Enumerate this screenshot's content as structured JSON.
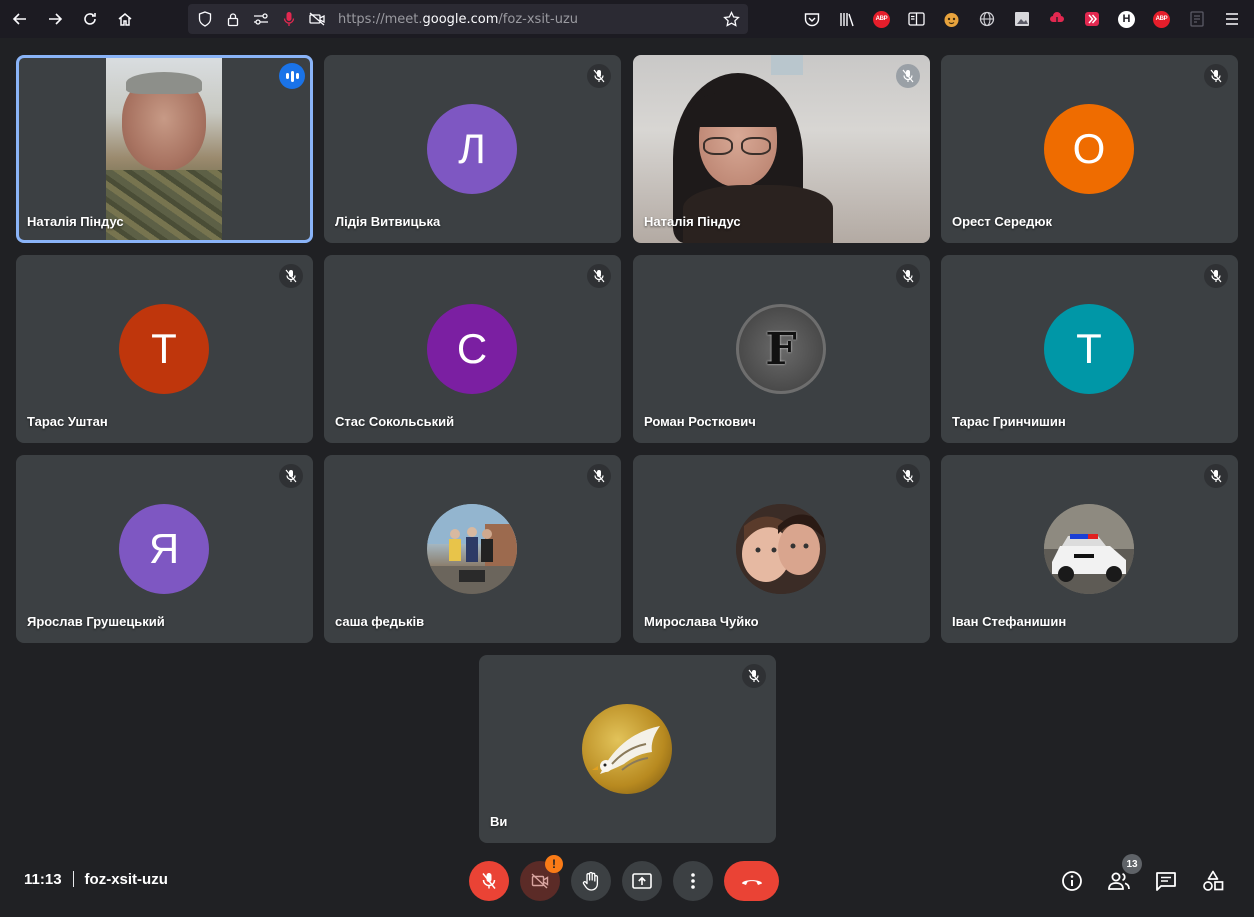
{
  "browser": {
    "url_prefix": "https://meet.",
    "url_domain": "google.com",
    "url_path": "/foz-xsit-uzu",
    "extensions": [
      {
        "icon": "pocket-icon"
      },
      {
        "icon": "library-icon"
      },
      {
        "icon": "adblock-icon",
        "label": "ABP"
      },
      {
        "icon": "reader-view-icon"
      },
      {
        "icon": "fox-extension-icon"
      },
      {
        "icon": "globe-icon"
      },
      {
        "icon": "screenshot-icon"
      },
      {
        "icon": "save-extension-icon"
      },
      {
        "icon": "video-extension-icon"
      },
      {
        "icon": "h-extension-icon",
        "label": "H"
      },
      {
        "icon": "adblock-icon-2",
        "label": "ABP"
      },
      {
        "icon": "disabled-extension-icon"
      },
      {
        "icon": "menu-icon"
      }
    ]
  },
  "participants": [
    {
      "name": "Наталія Піндус",
      "type": "video",
      "speaking": true
    },
    {
      "name": "Лідія Витвицька",
      "type": "letter",
      "letter": "Л",
      "color": "#7e57c2",
      "muted": true
    },
    {
      "name": "Наталія Піндус",
      "type": "video",
      "muted": true
    },
    {
      "name": "Орест Середюк",
      "type": "letter",
      "letter": "О",
      "color": "#ef6c00",
      "muted": true
    },
    {
      "name": "Тарас Уштан",
      "type": "letter",
      "letter": "Т",
      "color": "#bf360c",
      "muted": true
    },
    {
      "name": "Стас Сокольський",
      "type": "letter",
      "letter": "С",
      "color": "#7b1fa2",
      "muted": true
    },
    {
      "name": "Роман Росткович",
      "type": "photo",
      "letter": "F",
      "muted": true
    },
    {
      "name": "Тарас Гринчишин",
      "type": "letter",
      "letter": "Т",
      "color": "#0097a7",
      "muted": true
    },
    {
      "name": "Ярослав Грушецький",
      "type": "letter",
      "letter": "Я",
      "color": "#7e57c2",
      "muted": true
    },
    {
      "name": "саша федьків",
      "type": "photo",
      "muted": true
    },
    {
      "name": "Мирослава Чуйко",
      "type": "photo",
      "muted": true
    },
    {
      "name": "Іван Стефанишин",
      "type": "photo",
      "muted": true
    },
    {
      "name": "Ви",
      "type": "photo",
      "muted": true
    }
  ],
  "meeting": {
    "time": "11:13",
    "code": "foz-xsit-uzu",
    "people_count": "13",
    "camera_warning": "!"
  },
  "controls": [
    {
      "icon": "mic-off-icon",
      "state": "off"
    },
    {
      "icon": "camera-off-icon",
      "state": "off"
    },
    {
      "icon": "raise-hand-icon"
    },
    {
      "icon": "present-screen-icon"
    },
    {
      "icon": "more-options-icon"
    },
    {
      "icon": "end-call-icon"
    }
  ],
  "right_controls": [
    {
      "icon": "info-icon"
    },
    {
      "icon": "people-icon"
    },
    {
      "icon": "chat-icon"
    },
    {
      "icon": "activities-icon"
    }
  ],
  "colors": {
    "accent": "#8ab4f8",
    "danger": "#ea4335",
    "warning": "#fa7b17",
    "tile": "#3c4043",
    "background": "#202124"
  }
}
